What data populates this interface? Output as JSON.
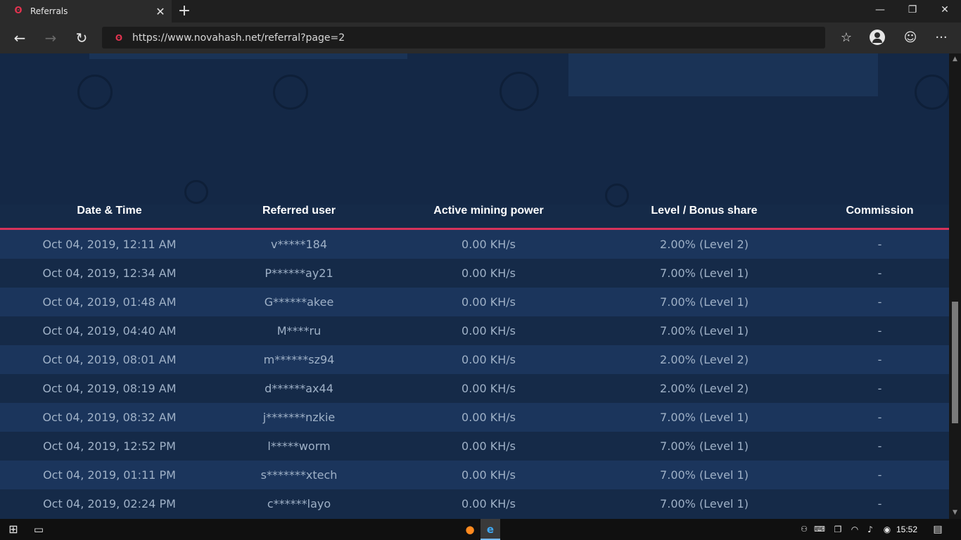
{
  "tab": {
    "title": "Referrals",
    "favicon": "novahash-logo-icon"
  },
  "window_controls": {
    "minimize": "—",
    "restore": "❐",
    "close": "✕"
  },
  "nav": {
    "back": "←",
    "forward": "→",
    "refresh": "↻"
  },
  "address_bar": {
    "url": "https://www.novahash.net/referral?page=2"
  },
  "toolbar_icons": {
    "favorites": "☆",
    "profile": "person-icon",
    "feedback": "☺",
    "more": "···"
  },
  "table": {
    "headers": [
      "Date & Time",
      "Referred user",
      "Active mining power",
      "Level / Bonus share",
      "Commission"
    ],
    "rows": [
      [
        "Oct 04, 2019, 12:11 AM",
        "v*****184",
        "0.00 KH/s",
        "2.00% (Level 2)",
        "-"
      ],
      [
        "Oct 04, 2019, 12:34 AM",
        "P******ay21",
        "0.00 KH/s",
        "7.00% (Level 1)",
        "-"
      ],
      [
        "Oct 04, 2019, 01:48 AM",
        "G******akee",
        "0.00 KH/s",
        "7.00% (Level 1)",
        "-"
      ],
      [
        "Oct 04, 2019, 04:40 AM",
        "M****ru",
        "0.00 KH/s",
        "7.00% (Level 1)",
        "-"
      ],
      [
        "Oct 04, 2019, 08:01 AM",
        "m******sz94",
        "0.00 KH/s",
        "2.00% (Level 2)",
        "-"
      ],
      [
        "Oct 04, 2019, 08:19 AM",
        "d******ax44",
        "0.00 KH/s",
        "2.00% (Level 2)",
        "-"
      ],
      [
        "Oct 04, 2019, 08:32 AM",
        "j*******nzkie",
        "0.00 KH/s",
        "7.00% (Level 1)",
        "-"
      ],
      [
        "Oct 04, 2019, 12:52 PM",
        "l*****worm",
        "0.00 KH/s",
        "7.00% (Level 1)",
        "-"
      ],
      [
        "Oct 04, 2019, 01:11 PM",
        "s*******xtech",
        "0.00 KH/s",
        "7.00% (Level 1)",
        "-"
      ],
      [
        "Oct 04, 2019, 02:24 PM",
        "c******layo",
        "0.00 KH/s",
        "7.00% (Level 1)",
        "-"
      ]
    ]
  },
  "taskbar": {
    "time": "15:52"
  }
}
